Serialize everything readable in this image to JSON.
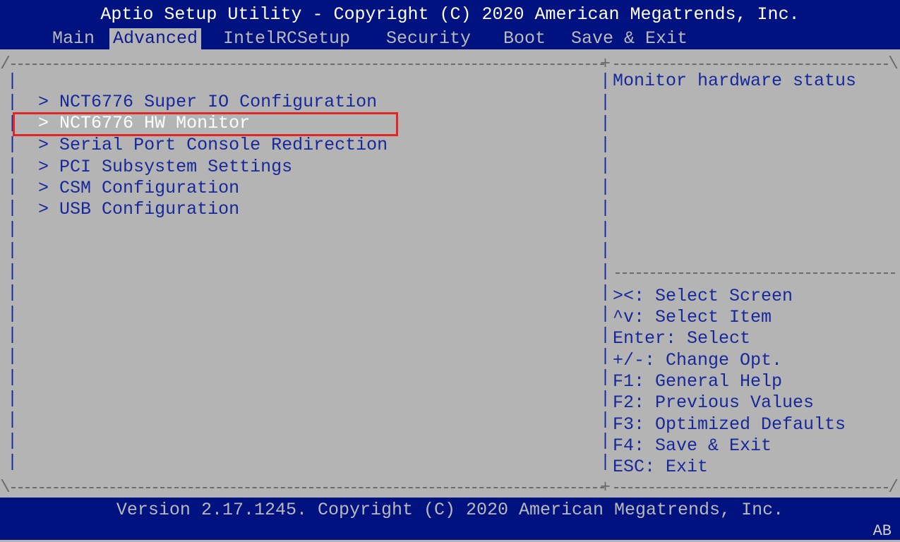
{
  "header": {
    "title": "Aptio Setup Utility - Copyright (C) 2020 American Megatrends, Inc.",
    "tabs": [
      "Main",
      "Advanced",
      "IntelRCSetup",
      "Security",
      "Boot",
      "Save & Exit"
    ],
    "active_tab": "Advanced"
  },
  "menu": {
    "items": [
      {
        "label": "NCT6776 Super IO Configuration"
      },
      {
        "label": "NCT6776 HW Monitor"
      },
      {
        "label": "Serial Port Console Redirection"
      },
      {
        "label": "PCI Subsystem Settings"
      },
      {
        "label": "CSM Configuration"
      },
      {
        "label": "USB Configuration"
      }
    ],
    "selected_item": "NCT6776 HW Monitor",
    "highlighted_item": "Serial Port Console Redirection",
    "submenu_marker": ">"
  },
  "help": {
    "description": "Monitor hardware status"
  },
  "keys": [
    "><: Select Screen",
    "^v: Select Item",
    "Enter: Select",
    "+/-: Change Opt.",
    "F1: General Help",
    "F2: Previous Values",
    "F3: Optimized Defaults",
    "F4: Save & Exit",
    "ESC: Exit"
  ],
  "footer": {
    "version": "Version 2.17.1245. Copyright (C) 2020 American Megatrends, Inc.",
    "lang": "AB"
  },
  "colors": {
    "header_bg": "#00127f",
    "body_bg": "#b4b4b4",
    "text": "#17289a",
    "selected_text": "#ffffff",
    "highlight_box": "#e0282b"
  }
}
